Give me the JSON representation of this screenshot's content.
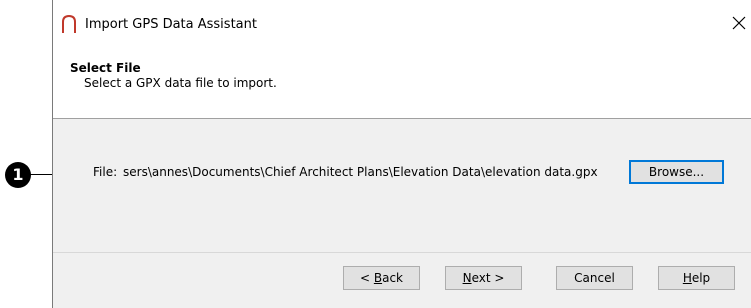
{
  "window": {
    "title": "Import GPS Data Assistant",
    "close_glyph": "✕",
    "app_icon": "chief-architect-arch-icon"
  },
  "header": {
    "title": "Select File",
    "subtitle": "Select a GPX data file to import."
  },
  "file_row": {
    "label": "File:",
    "path": "sers\\annes\\Documents\\Chief Architect Plans\\Elevation Data\\elevation data.gpx",
    "browse_label": "Browse..."
  },
  "buttons": {
    "back_prefix": "< ",
    "back_mnemonic": "B",
    "back_rest": "ack",
    "next_mnemonic": "N",
    "next_rest": "ext >",
    "cancel_label": "Cancel",
    "help_mnemonic": "H",
    "help_rest": "elp"
  },
  "callout": {
    "number": "1"
  },
  "colors": {
    "accent": "#0078d7",
    "icon_red": "#c0392b"
  }
}
